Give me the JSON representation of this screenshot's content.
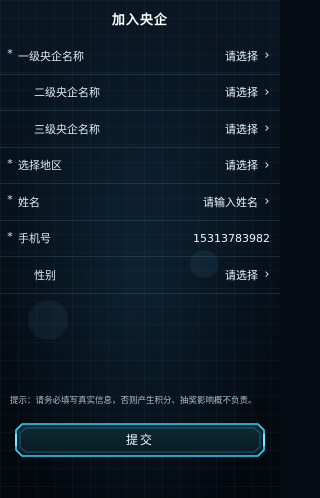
{
  "header": {
    "title": "加入央企"
  },
  "form": {
    "fields": [
      {
        "required": "*",
        "label": "一级央企名称",
        "value": "请选择",
        "chevron": "›"
      },
      {
        "required": "",
        "label": "二级央企名称",
        "value": "请选择",
        "chevron": "›"
      },
      {
        "required": "",
        "label": "三级央企名称",
        "value": "请选择",
        "chevron": "›"
      },
      {
        "required": "*",
        "label": "选择地区",
        "value": "请选择",
        "chevron": "›"
      },
      {
        "required": "*",
        "label": "姓名",
        "value": "请输入姓名",
        "chevron": "›"
      },
      {
        "required": "*",
        "label": "手机号",
        "value": "15313783982",
        "chevron": ""
      },
      {
        "required": "",
        "label": "性别",
        "value": "请选择",
        "chevron": "›"
      }
    ]
  },
  "hint": {
    "text": "提示：请务必填写真实信息，否则产生积分、抽奖影响概不负责。"
  },
  "submit": {
    "label": "提交"
  },
  "colors": {
    "accent": "#2fd6ff",
    "background": "#050c14"
  }
}
